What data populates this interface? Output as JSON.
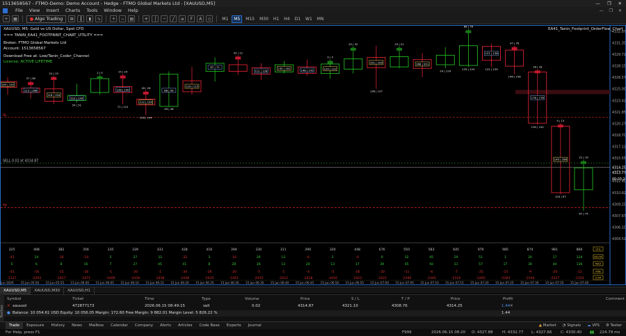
{
  "window": {
    "title": "1513658567 - FTMO-Demo: Demo Account - Hedge - FTMO Global Markets Ltd - [XAUUSD,M5]",
    "controls": [
      "—",
      "❐",
      "✕"
    ]
  },
  "menu": {
    "items": [
      "File",
      "View",
      "Insert",
      "Charts",
      "Tools",
      "Window",
      "Help"
    ],
    "window_controls": [
      "—",
      "❐",
      "✕"
    ]
  },
  "toolbar": {
    "algo_label": "Algo Trading",
    "timeframes": [
      "M1",
      "M5",
      "M15",
      "M30",
      "H1",
      "H4",
      "D1",
      "W1",
      "MN"
    ],
    "active_timeframe": "M5"
  },
  "chart_info": {
    "symbol_line": "XAUUSD, M5:  Gold vs US Dollar, Spot CFD",
    "utility_name": "=== TANIN_EA41_FOOTPRINT_CHART_UTILITY ===",
    "broker": "Broker: FTMO Global Markets Ltd",
    "account": "Account: 1513658567",
    "download": "Download Free at: Low/Tanin_Coder_Channel",
    "license": "License: ACTIVE LIFETIME",
    "indicator_name": "EA41_Tanin_Footprint_OrderFlow_Chart",
    "sell_label": "SELL 0.02 at 4314.87",
    "tp_label": "TP",
    "sl_label": "SL"
  },
  "price_axis": {
    "ticks": [
      "4332.87",
      "4331.30",
      "4329.72",
      "4328.15",
      "4326.57",
      "4325.00",
      "4323.42",
      "4321.85",
      "4320.27",
      "4318.70",
      "4317.12",
      "4315.55",
      "4313.97",
      "4312.40",
      "4310.82",
      "4309.25",
      "4307.67",
      "4306.10",
      "4304.52"
    ],
    "current_price": "4314.25",
    "current_price_2": "4313.77",
    "timer": "00:03:20"
  },
  "stats_rows": {
    "labels": [
      "VOL",
      "DELTA",
      "MAX",
      "MIN",
      "CUM"
    ],
    "vol": [
      "325",
      "408",
      "382",
      "356",
      "335",
      "339",
      "333",
      "428",
      "416",
      "394",
      "330",
      "311",
      "290",
      "320",
      "448",
      "676",
      "550",
      "583",
      "645",
      "979",
      "985",
      "874",
      "981",
      "866"
    ],
    "delta": [
      "-41",
      "24",
      "-16",
      "-14",
      "5",
      "27",
      "33",
      "-32",
      "3",
      "-16",
      "26",
      "13",
      "-6",
      "2",
      "-6",
      "0",
      "32",
      "45",
      "29",
      "51",
      "1",
      "20",
      "17",
      "124"
    ],
    "max": [
      "5",
      "6",
      "8",
      "16",
      "7",
      "27",
      "45",
      "41",
      "8",
      "28",
      "26",
      "13",
      "20",
      "13",
      "17",
      "39",
      "45",
      "50",
      "31",
      "57",
      "17",
      "30",
      "44",
      "136"
    ],
    "min": [
      "-41",
      "-16",
      "-15",
      "-26",
      "-1",
      "-20",
      "-1",
      "-34",
      "-26",
      "-20",
      "-5",
      "-1",
      "-4",
      "-5",
      "-26",
      "-20",
      "-11",
      "-6",
      "-7",
      "-25",
      "-15",
      "-9",
      "-20",
      "-12"
    ],
    "cum": [
      "-2317",
      "-2293",
      "-2457",
      "-2471",
      "-2466",
      "-2439",
      "-2406",
      "-2438",
      "-2435",
      "-2451",
      "-2425",
      "-2412",
      "-2418",
      "-2416",
      "-2422",
      "-2422",
      "-2390",
      "-2345",
      "-2316",
      "-2265",
      "-2264",
      "-2244",
      "-2227",
      "-2103"
    ]
  },
  "time_axis": [
    "15 Jun 2026",
    "15 Jun 05:50",
    "15 Jun 05:55",
    "15 Jun 06:00",
    "15 Jun 06:05",
    "15 Jun 06:10",
    "15 Jun 06:15",
    "15 Jun 06:20",
    "15 Jun 06:25",
    "15 Jun 06:30",
    "15 Jun 06:35",
    "15 Jun 06:40",
    "15 Jun 06:45",
    "15 Jun 06:50",
    "15 Jun 06:55",
    "15 Jun 07:00",
    "15 Jun 07:05",
    "15 Jun 07:10",
    "15 Jun 07:15",
    "15 Jun 07:20",
    "15 Jun 07:25",
    "15 Jun 07:30",
    "15 Jun 07:35",
    "15 Jun 07:40"
  ],
  "candles": [
    {
      "o": 4326.0,
      "c": 4325.2,
      "h": 4326.6,
      "l": 4324.2,
      "box": "183 | 145",
      "top": "",
      "bot": ""
    },
    {
      "o": 4325.1,
      "c": 4324.5,
      "h": 4326.1,
      "l": 4323.7,
      "box": "113 | 166",
      "top": "37 | 38",
      "bot": ""
    },
    {
      "o": 4325.0,
      "c": 4323.3,
      "h": 4326.8,
      "l": 4322.9,
      "box": "116 | 154",
      "top": "24 | 15",
      "bot": ""
    },
    {
      "o": 4323.4,
      "c": 4324.1,
      "h": 4325.7,
      "l": 4323.1,
      "box": "110 | 144",
      "top": "",
      "bot": "54 | 51"
    },
    {
      "o": 4324.5,
      "c": 4326.4,
      "h": 4326.9,
      "l": 4324.2,
      "box": "",
      "top": "2 | 5",
      "bot": ""
    },
    {
      "o": 4325.3,
      "c": 4324.5,
      "h": 4327.0,
      "l": 4322.9,
      "box": "138 | 140",
      "top": "15 | 24",
      "bot": "71 | 112"
    },
    {
      "o": 4323.6,
      "c": 4322.8,
      "h": 4324.8,
      "l": 4321.4,
      "box": "112 | 129",
      "top": "18 | 26",
      "bot": "136 | 144"
    },
    {
      "o": 4322.6,
      "c": 4327.0,
      "h": 4327.4,
      "l": 4322.6,
      "box": "88 | 50",
      "top": "",
      "bot": "46 | 48"
    },
    {
      "o": 4326.1,
      "c": 4324.6,
      "h": 4328.0,
      "l": 4324.2,
      "box": "119 | 115",
      "top": "",
      "bot": ""
    },
    {
      "o": 4327.4,
      "c": 4328.5,
      "h": 4329.3,
      "l": 4326.0,
      "box": "87 | 71",
      "top": "",
      "bot": ""
    },
    {
      "o": 4328.3,
      "c": 4327.4,
      "h": 4329.6,
      "l": 4326.9,
      "box": "",
      "top": "33 | 12",
      "bot": ""
    },
    {
      "o": 4327.9,
      "c": 4327.0,
      "h": 4328.5,
      "l": 4326.2,
      "box": "112 | 128",
      "top": "",
      "bot": ""
    },
    {
      "o": 4327.3,
      "c": 4328.3,
      "h": 4328.8,
      "l": 4327.1,
      "box": "130 | 161",
      "top": "",
      "bot": ""
    },
    {
      "o": 4328.0,
      "c": 4327.1,
      "h": 4329.0,
      "l": 4326.8,
      "box": "148 | 142",
      "top": "",
      "bot": ""
    },
    {
      "o": 4327.1,
      "c": 4328.4,
      "h": 4329.0,
      "l": 4326.4,
      "box": "124 | 122",
      "top": "0 | 4",
      "bot": ""
    },
    {
      "o": 4327.7,
      "c": 4329.1,
      "h": 4330.8,
      "l": 4327.1,
      "box": "",
      "top": "25 | 32",
      "bot": ""
    },
    {
      "o": 4329.3,
      "c": 4327.9,
      "h": 4330.9,
      "l": 4325.0,
      "box": "151 | 150",
      "top": "",
      "bot": "136 | 137"
    },
    {
      "o": 4328.0,
      "c": 4329.4,
      "h": 4330.8,
      "l": 4327.8,
      "box": "",
      "top": "23 | 21",
      "bot": ""
    },
    {
      "o": 4329.0,
      "c": 4327.8,
      "h": 4329.9,
      "l": 4326.6,
      "box": "166 | 201",
      "top": "",
      "bot": ""
    },
    {
      "o": 4328.3,
      "c": 4329.6,
      "h": 4330.7,
      "l": 4327.8,
      "box": "",
      "top": "",
      "bot": "24 | 124"
    },
    {
      "o": 4328.2,
      "c": 4330.9,
      "h": 4333.2,
      "l": 4328.0,
      "box": "",
      "top": "88 | 76",
      "bot": "129 | 129"
    },
    {
      "o": 4330.8,
      "c": 4328.9,
      "h": 4331.2,
      "l": 4328.0,
      "box": "137 | 138",
      "top": "",
      "bot": "122 | 139"
    },
    {
      "o": 4330.3,
      "c": 4328.1,
      "h": 4330.9,
      "l": 4327.0,
      "box": "",
      "top": "47 | 76",
      "bot": "146 | 156"
    },
    {
      "o": 4327.3,
      "c": 4320.3,
      "h": 4327.7,
      "l": 4320.1,
      "box": "176 | 178",
      "top": "18 | 18",
      "bot": "130 | 152"
    },
    {
      "o": 4319.9,
      "c": 4310.8,
      "h": 4320.3,
      "l": 4310.6,
      "box": "145 | 168",
      "top": "9 | 13",
      "bot": "104 | 97"
    },
    {
      "o": 4311.2,
      "c": 4314.2,
      "h": 4315.3,
      "l": 4308.3,
      "box": "",
      "top": "22 | 19",
      "bot": "67 | 74"
    }
  ],
  "tabs": [
    "XAUUSD,M5",
    "XAUUSD,M30",
    "XAUUSD,H1"
  ],
  "terminal": {
    "headers": [
      "Symbol",
      "Ticket",
      "Time",
      "Type",
      "Volume",
      "Price",
      "S / L",
      "T / P",
      "Price",
      "Profit",
      "Comment"
    ],
    "position": {
      "symbol": "xauusd",
      "ticket": "472877173",
      "time": "2026.06.15 08:49:15",
      "type": "sell",
      "volume": "0.02",
      "price": "4314.87",
      "sl": "4321.10",
      "tp": "4308.76",
      "current": "4314.25",
      "profit": "1.44"
    },
    "balance_line": "Balance: 10 054.61 USD  Equity: 10 056.05  Margin: 172.60  Free Margin: 9 882.01  Margin Level: 5 826.22 %",
    "total_profit": "1.44"
  },
  "bottom_tabs": [
    "Trade",
    "Exposure",
    "History",
    "News",
    "Mailbox",
    "Calendar",
    "Company",
    "Alerts",
    "Articles",
    "Code Base",
    "Experts",
    "Journal"
  ],
  "bottom_right": [
    "Market",
    "Signals",
    "VPS",
    "Tester"
  ],
  "status": {
    "left": "For Help, press F1",
    "profile": "F999",
    "datetime": "2026.06.15 08:20",
    "open": "O: 4327.88",
    "high": "H: 4332.77",
    "low": "L: 4327.66",
    "close": "C: 4330.40",
    "ping": "224.79 ms"
  },
  "colors": {
    "bull": "#22bb22",
    "bear": "#dd2233",
    "axis": "#2c6fc9"
  }
}
